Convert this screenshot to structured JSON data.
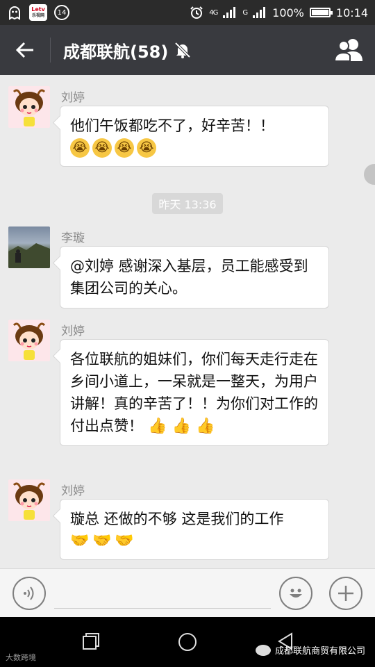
{
  "status_bar": {
    "app_badge_top": "Letv",
    "app_badge_bottom": "乐视网",
    "notification_count": "14",
    "network_1": "4G",
    "network_2": "G",
    "battery": "100%",
    "battery_level": 1.0,
    "time": "10:14"
  },
  "header": {
    "back_icon": "arrow-left",
    "title": "成都联航(58)",
    "mute_icon": "bell-off",
    "members_icon": "group-members"
  },
  "messages": [
    {
      "sender": "刘婷",
      "avatar": "cartoon-girl-avatar",
      "text": "他们午饭都吃不了，好辛苦！！",
      "emojis": [
        "😭",
        "😭",
        "😭",
        "😭"
      ]
    },
    {
      "sender": "李璇",
      "avatar": "landscape-avatar",
      "text": "@刘婷 感谢深入基层，员工能感受到集团公司的关心。",
      "emojis": []
    },
    {
      "sender": "刘婷",
      "avatar": "cartoon-girl-avatar",
      "text": "各位联航的姐妹们，你们每天走行走在乡间小道上，一呆就是一整天，为用户讲解！真的辛苦了！！为你们对工作的付出点赞！",
      "emojis": [
        "👍",
        "👍",
        "👍"
      ]
    },
    {
      "sender": "刘婷",
      "avatar": "cartoon-girl-avatar",
      "text": "璇总 还做的不够 这是我们的工作",
      "emojis": [
        "🤝",
        "🤝",
        "🤝"
      ]
    }
  ],
  "timestamp": "昨天 13:36",
  "input_bar": {
    "voice_icon": "voice",
    "emoji_icon": "smiley",
    "plus_icon": "plus"
  },
  "nav_bar": {
    "recents_icon": "square",
    "home_icon": "circle",
    "back_icon": "triangle"
  },
  "watermark": {
    "left": "大数跨境",
    "right": "成都联航商贸有限公司"
  }
}
